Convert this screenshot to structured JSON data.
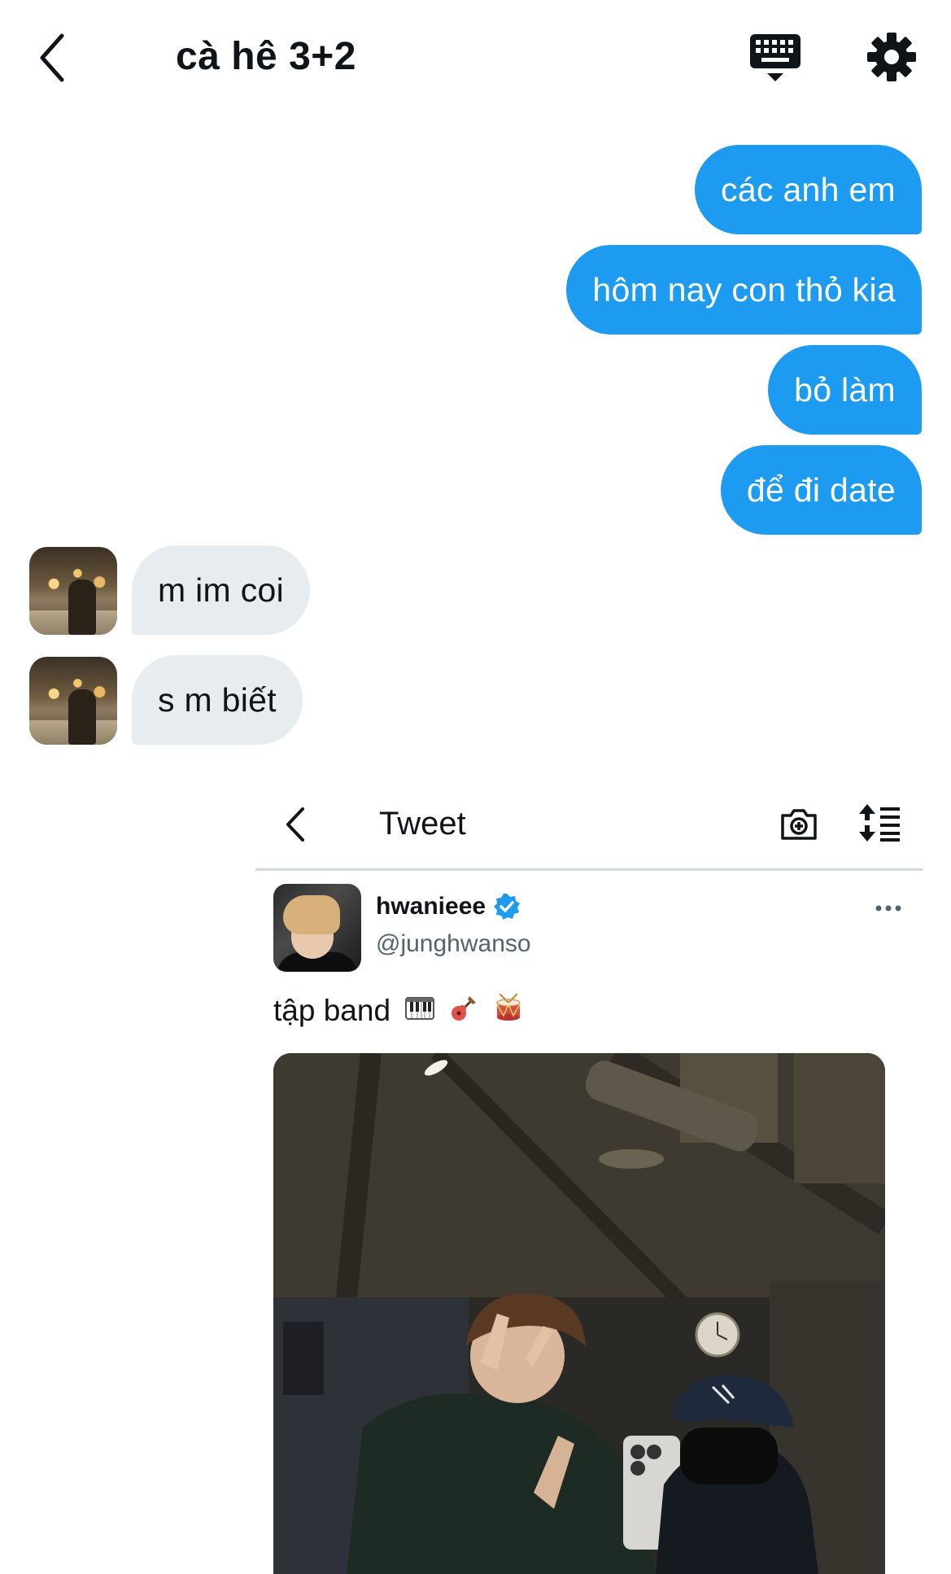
{
  "header": {
    "title": "cà hê 3+2"
  },
  "messages": {
    "sent": [
      "các anh em",
      "hôm nay con thỏ kia",
      "bỏ làm",
      "để đi date"
    ],
    "received": [
      "m im coi",
      "s m biết"
    ]
  },
  "tweet": {
    "header_title": "Tweet",
    "author_name": "hwanieee",
    "author_handle": "@junghwanso",
    "text": "tập band",
    "emojis": [
      "piano",
      "guitar",
      "drum"
    ]
  },
  "colors": {
    "accent": "#1d9bf0",
    "incoming_bubble": "#e7ecf0"
  }
}
